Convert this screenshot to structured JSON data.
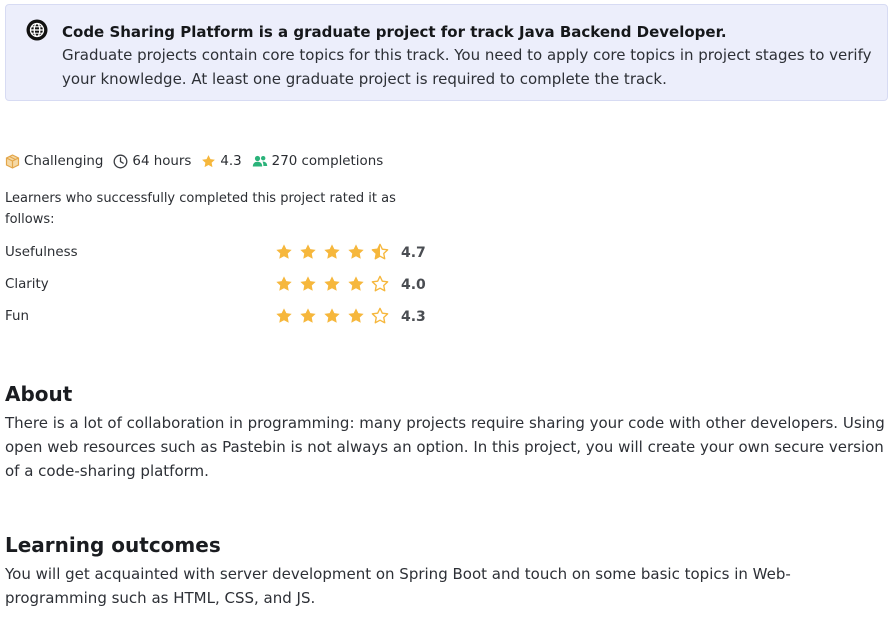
{
  "banner": {
    "title": "Code Sharing Platform is a graduate project for track Java Backend Developer.",
    "description": "Graduate projects contain core topics for this track. You need to apply core topics in project stages to verify your knowledge. At least one graduate project is required to complete the track."
  },
  "meta": {
    "difficulty": "Challenging",
    "duration": "64 hours",
    "rating": "4.3",
    "completions": "270 completions"
  },
  "ratings_intro": "Learners who successfully completed this project rated it as follows:",
  "ratings": [
    {
      "label": "Usefulness",
      "value": "4.7",
      "stars": [
        "full",
        "full",
        "full",
        "full",
        "half"
      ]
    },
    {
      "label": "Clarity",
      "value": "4.0",
      "stars": [
        "full",
        "full",
        "full",
        "full",
        "empty"
      ]
    },
    {
      "label": "Fun",
      "value": "4.3",
      "stars": [
        "full",
        "full",
        "full",
        "full",
        "empty"
      ]
    }
  ],
  "about": {
    "heading": "About",
    "text": "There is a lot of collaboration in programming: many projects require sharing your code with other developers. Using open web resources such as Pastebin is not always an option. In this project, you will create your own secure version of a code-sharing platform."
  },
  "learning_outcomes": {
    "heading": "Learning outcomes",
    "text": "You will get acquainted with server development on Spring Boot and touch on some basic topics in Web-programming such as HTML, CSS, and JS."
  },
  "colors": {
    "star": "#f6b73c",
    "banner_bg": "#eceefb",
    "box_icon": "#e3a64a",
    "users_icon": "#2bb37a"
  }
}
